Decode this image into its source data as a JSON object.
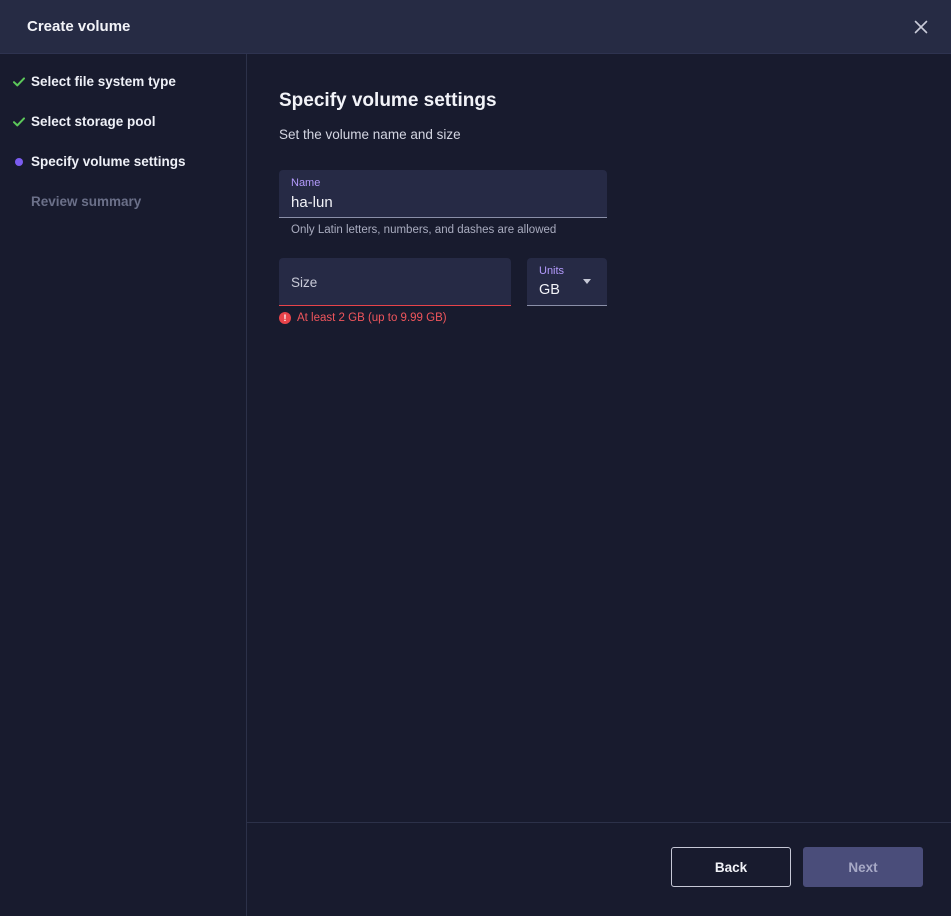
{
  "dialog": {
    "title": "Create volume"
  },
  "steps": [
    {
      "label": "Select file system type",
      "state": "done",
      "icon": "check-icon"
    },
    {
      "label": "Select storage pool",
      "state": "done",
      "icon": "check-icon"
    },
    {
      "label": "Specify volume settings",
      "state": "current",
      "icon": "dot-icon"
    },
    {
      "label": "Review summary",
      "state": "pending",
      "icon": ""
    }
  ],
  "main": {
    "title": "Specify volume settings",
    "subtitle": "Set the volume name and size",
    "name_field": {
      "label": "Name",
      "value": "ha-lun",
      "helper": "Only Latin letters, numbers, and dashes are allowed"
    },
    "size_field": {
      "placeholder": "Size",
      "error": "At least 2 GB (up to 9.99 GB)"
    },
    "units_field": {
      "label": "Units",
      "value": "GB"
    }
  },
  "footer": {
    "back_label": "Back",
    "next_label": "Next"
  },
  "colors": {
    "accent": "#7b5cf0",
    "success": "#5cc85a",
    "error": "#f0555c",
    "background": "#181b2e",
    "header": "#262b44"
  }
}
